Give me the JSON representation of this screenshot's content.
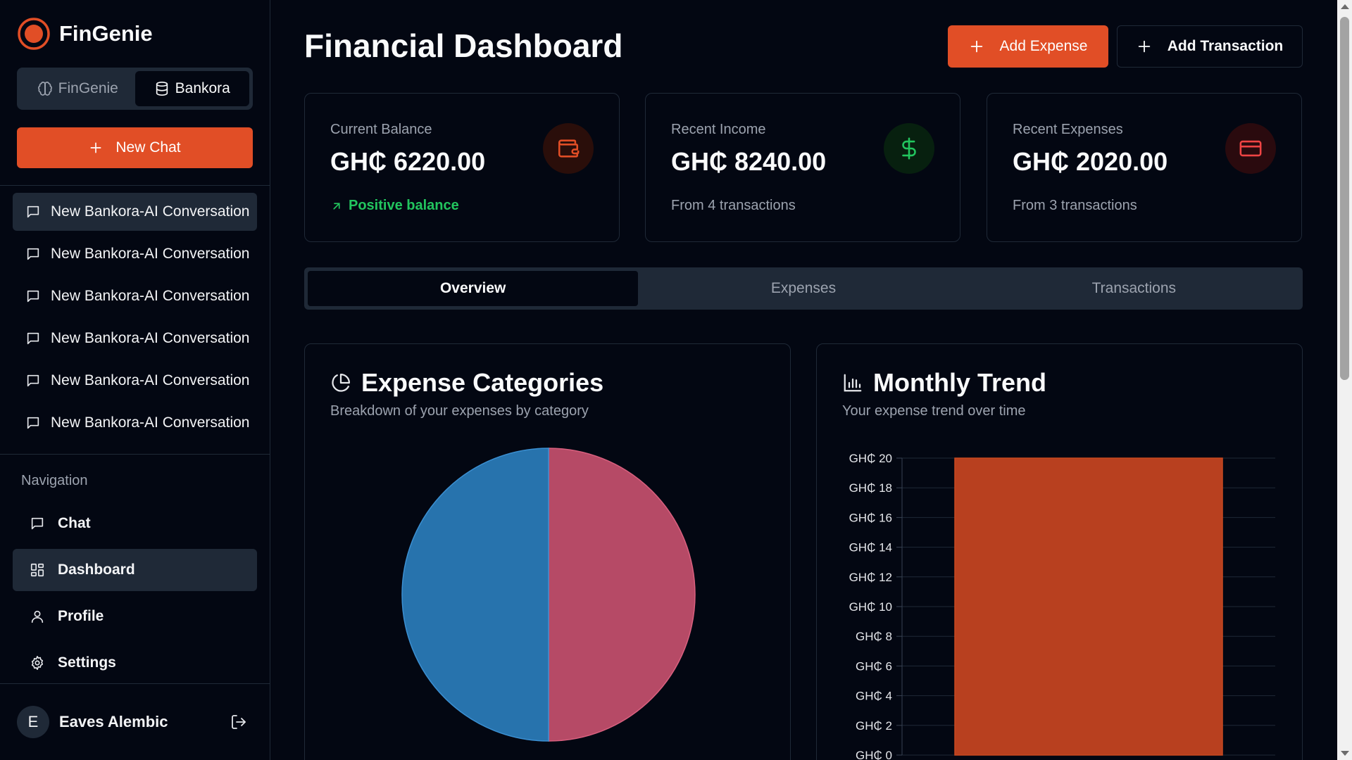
{
  "app": {
    "name": "FinGenie"
  },
  "switcher": {
    "items": [
      {
        "label": "FinGenie",
        "active": false
      },
      {
        "label": "Bankora",
        "active": true
      }
    ]
  },
  "sidebar": {
    "new_chat_label": "New Chat",
    "conversations": [
      {
        "title": "New Bankora-AI Conversation",
        "active": true
      },
      {
        "title": "New Bankora-AI Conversation",
        "active": false
      },
      {
        "title": "New Bankora-AI Conversation",
        "active": false
      },
      {
        "title": "New Bankora-AI Conversation",
        "active": false
      },
      {
        "title": "New Bankora-AI Conversation",
        "active": false
      },
      {
        "title": "New Bankora-AI Conversation",
        "active": false
      }
    ],
    "nav_heading": "Navigation",
    "nav": [
      {
        "label": "Chat",
        "icon": "chat-icon",
        "active": false
      },
      {
        "label": "Dashboard",
        "icon": "dashboard-icon",
        "active": true
      },
      {
        "label": "Profile",
        "icon": "user-icon",
        "active": false
      },
      {
        "label": "Settings",
        "icon": "gear-icon",
        "active": false
      }
    ],
    "user": {
      "initial": "E",
      "name": "Eaves Alembic"
    }
  },
  "header": {
    "title": "Financial Dashboard",
    "add_expense_label": "Add Expense",
    "add_transaction_label": "Add Transaction"
  },
  "cards": [
    {
      "label": "Current Balance",
      "value": "GH₵ 6220.00",
      "note": "Positive balance",
      "icon": "wallet-icon",
      "accent": "#e14e26"
    },
    {
      "label": "Recent Income",
      "value": "GH₵ 8240.00",
      "note": "From 4 transactions",
      "icon": "dollar-icon",
      "accent": "#22c55e"
    },
    {
      "label": "Recent Expenses",
      "value": "GH₵ 2020.00",
      "note": "From 3 transactions",
      "icon": "credit-card-icon",
      "accent": "#ef4444"
    }
  ],
  "tabs": [
    {
      "label": "Overview",
      "active": true
    },
    {
      "label": "Expenses",
      "active": false
    },
    {
      "label": "Transactions",
      "active": false
    }
  ],
  "panels": {
    "categories": {
      "title": "Expense Categories",
      "subtitle": "Breakdown of your expenses by category"
    },
    "trend": {
      "title": "Monthly Trend",
      "subtitle": "Your expense trend over time"
    }
  },
  "colors": {
    "accent": "#e14e26",
    "positive": "#22c55e",
    "pie_blue": "#2773ad",
    "pie_pink": "#b64a66",
    "bar": "#b8401f"
  },
  "chart_data": [
    {
      "type": "pie",
      "slices": [
        {
          "value": 50,
          "color": "#b64a66"
        },
        {
          "value": 50,
          "color": "#2773ad"
        }
      ]
    },
    {
      "type": "bar",
      "y_tick_labels": [
        "GH₵ 0",
        "GH₵ 2",
        "GH₵ 4",
        "GH₵ 6",
        "GH₵ 8",
        "GH₵ 10",
        "GH₵ 12",
        "GH₵ 14",
        "GH₵ 16",
        "GH₵ 18",
        "GH₵ 20"
      ],
      "ylim": [
        0,
        20
      ],
      "values": [
        20
      ],
      "color": "#b8401f",
      "grid": true
    }
  ]
}
